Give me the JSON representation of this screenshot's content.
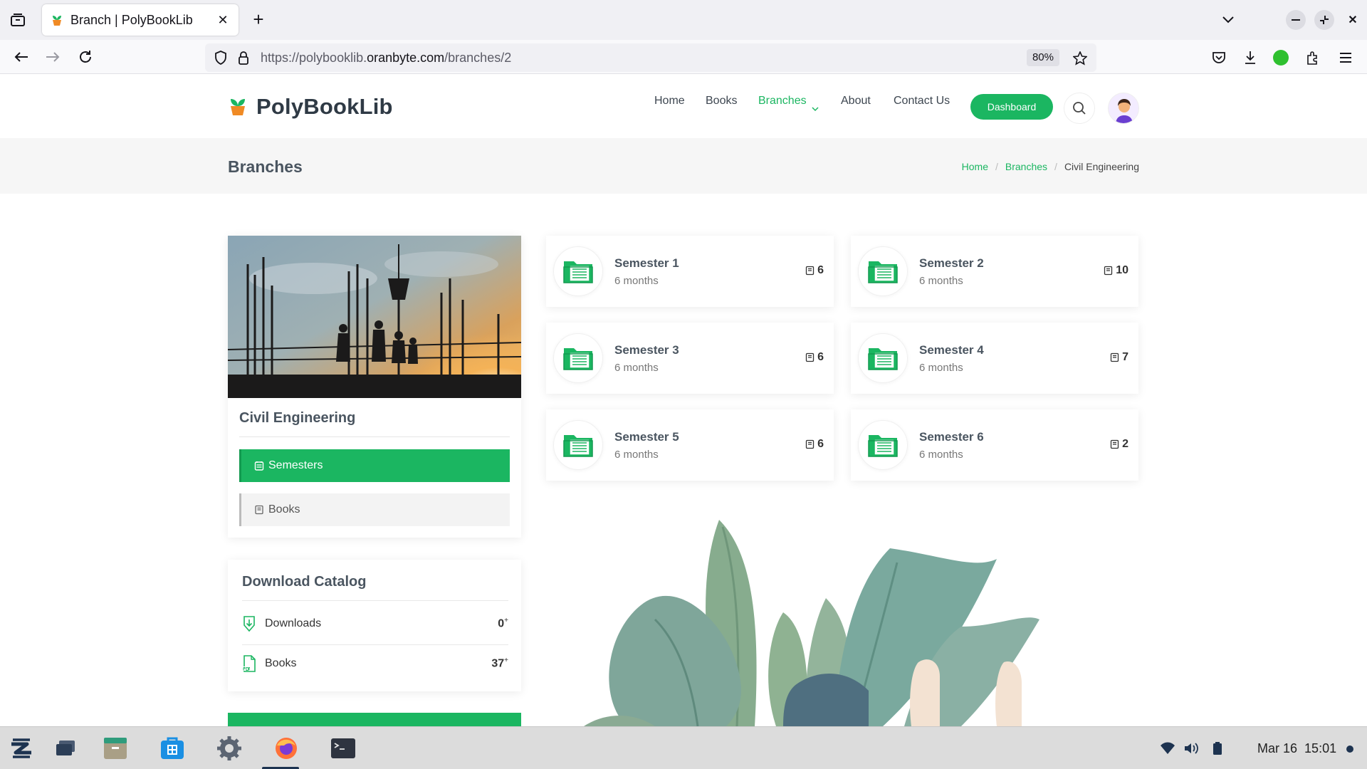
{
  "browser": {
    "tab_title": "Branch | PolyBookLib",
    "url_prefix": "https://polybooklib.",
    "url_domain": "oranbyte.com",
    "url_path": "/branches/2",
    "zoom": "80%"
  },
  "site": {
    "brand": "PolyBookLib",
    "menu": {
      "home": "Home",
      "books": "Books",
      "branches": "Branches",
      "about": "About",
      "contact": "Contact Us"
    },
    "dashboard_label": "Dashboard",
    "accent_color": "#1bb661"
  },
  "page": {
    "title": "Branches",
    "breadcrumb": [
      "Home",
      "Branches",
      "Civil Engineering"
    ]
  },
  "branch": {
    "name": "Civil Engineering",
    "nav": {
      "semesters": "Semesters",
      "books": "Books"
    }
  },
  "catalog": {
    "title": "Download Catalog",
    "rows": [
      {
        "label": "Downloads",
        "value": "0",
        "mark": "+"
      },
      {
        "label": "Books",
        "value": "37",
        "mark": "+"
      }
    ]
  },
  "semesters": [
    {
      "name": "Semester 1",
      "duration": "6 months",
      "count": "6"
    },
    {
      "name": "Semester 2",
      "duration": "6 months",
      "count": "10"
    },
    {
      "name": "Semester 3",
      "duration": "6 months",
      "count": "6"
    },
    {
      "name": "Semester 4",
      "duration": "6 months",
      "count": "7"
    },
    {
      "name": "Semester 5",
      "duration": "6 months",
      "count": "6"
    },
    {
      "name": "Semester 6",
      "duration": "6 months",
      "count": "2"
    }
  ],
  "taskbar": {
    "date": "Mar 16",
    "time": "15:01"
  }
}
